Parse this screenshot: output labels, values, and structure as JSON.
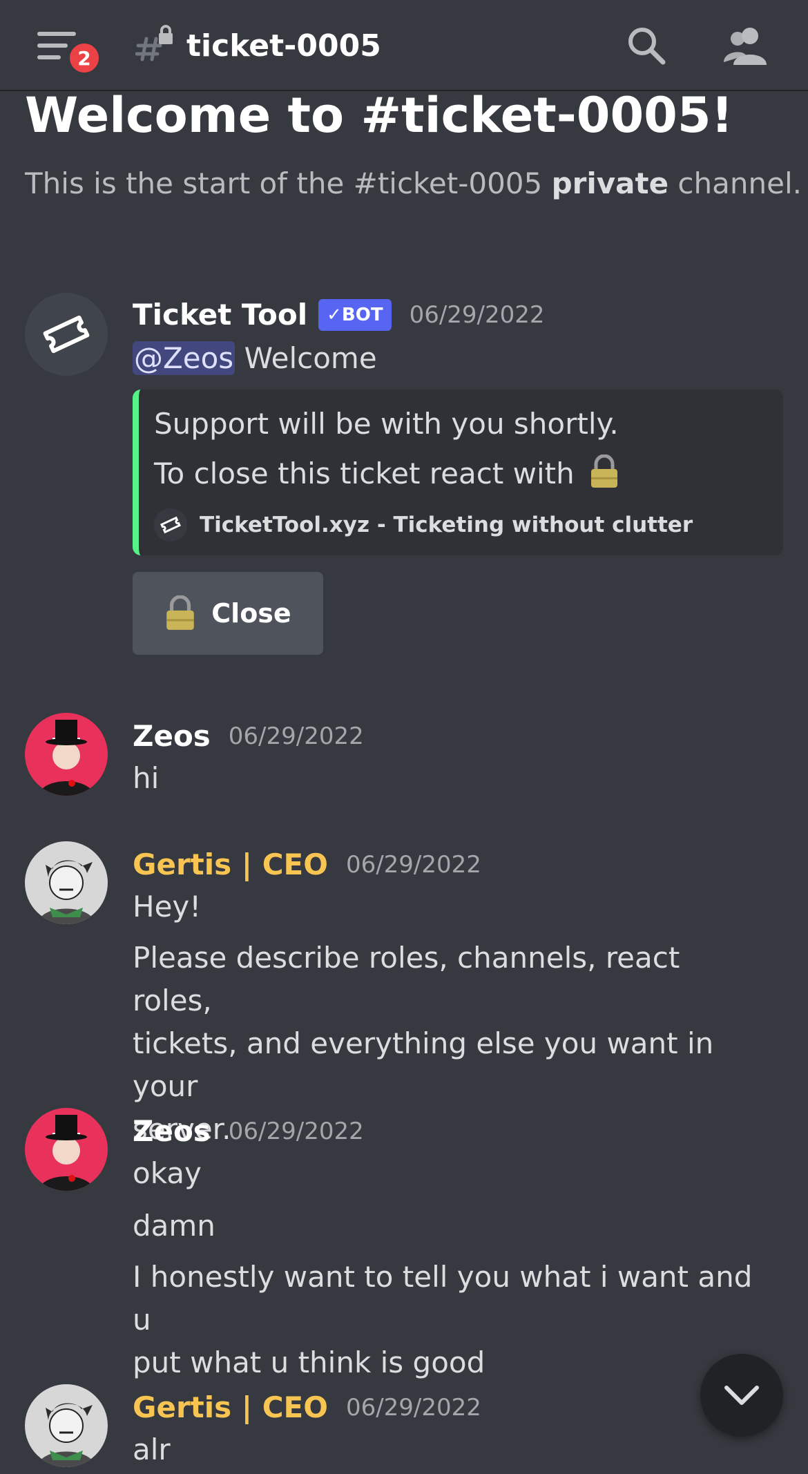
{
  "header": {
    "channel_name": "ticket-0005",
    "notification_count": "2",
    "icons": [
      "menu-icon",
      "locked-channel-icon",
      "search-icon",
      "members-icon"
    ]
  },
  "intro": {
    "title": "Welcome to #ticket-0005!",
    "sub_before": "This is the start of the #ticket-0005 ",
    "sub_bold": "private",
    "sub_after": " channel."
  },
  "messages": [
    {
      "author": "Ticket Tool",
      "bot_badge": "✓BOT",
      "timestamp": "06/29/2022",
      "mention": "@Zeos",
      "text": "Welcome",
      "embed": {
        "line1": "Support will be with you shortly.",
        "line2": "To close this ticket react with",
        "footer": "TicketTool.xyz - Ticketing without clutter",
        "accent": "#57f287"
      },
      "button_label": "Close"
    },
    {
      "author": "Zeos",
      "timestamp": "06/29/2022",
      "lines": [
        "hi"
      ]
    },
    {
      "author": "Gertis | CEO",
      "timestamp": "06/29/2022",
      "name_color": "#f8c553",
      "lines": [
        "Hey!",
        "Please describe roles, channels, react roles,",
        "tickets, and everything else you want in your",
        "server."
      ]
    },
    {
      "author": "Zeos",
      "timestamp": "06/29/2022",
      "lines": [
        "okay",
        "damn",
        "I honestly want to tell you what i want and u",
        "put what u think is good"
      ]
    },
    {
      "author": "Gertis | CEO",
      "timestamp": "06/29/2022",
      "name_color": "#f8c553",
      "lines": [
        "alr"
      ]
    }
  ],
  "colors": {
    "background": "#36393f",
    "bot_badge": "#5865f2",
    "badge_red": "#ed4245"
  }
}
